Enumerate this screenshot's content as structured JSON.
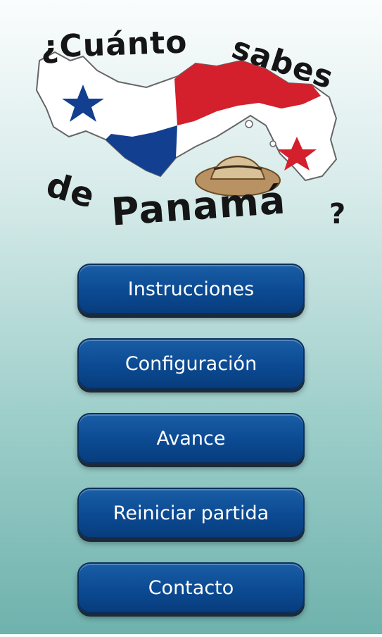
{
  "logo": {
    "line1_word1": "¿Cuánto",
    "line1_word2": "sabes",
    "line2_word1": "de",
    "line2_word2": "Panamá",
    "line2_mark": "?",
    "colors": {
      "flag_red": "#d41f2d",
      "flag_blue": "#123f8f",
      "map_white": "#ffffff",
      "hat": "#c7a16a"
    }
  },
  "menu": {
    "items": [
      {
        "label": "Instrucciones"
      },
      {
        "label": "Configuración"
      },
      {
        "label": "Avance"
      },
      {
        "label": "Reiniciar partida"
      },
      {
        "label": "Contacto"
      }
    ]
  },
  "theme": {
    "button_blue": "#0b4a92",
    "background_top": "#fbfdfd",
    "background_bottom": "#6fb2ad"
  }
}
